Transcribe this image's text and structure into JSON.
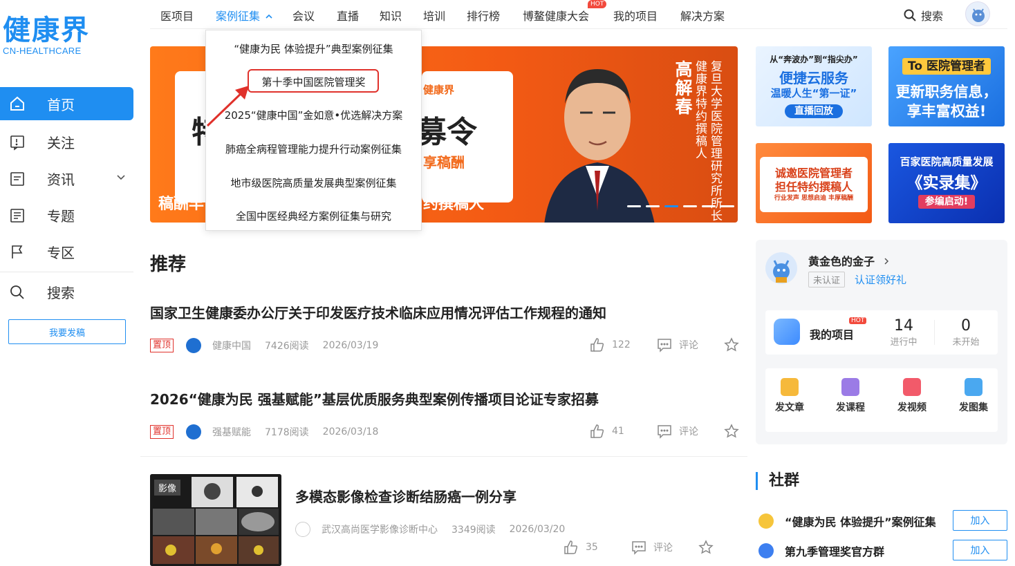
{
  "logo": {
    "cn": "健康界",
    "en": "CN-HEALTHCARE"
  },
  "sidebar": {
    "items": [
      {
        "label": "首页",
        "icon": "home-icon"
      },
      {
        "label": "关注",
        "icon": "follow-icon"
      },
      {
        "label": "资讯",
        "icon": "news-icon"
      },
      {
        "label": "专题",
        "icon": "topic-icon"
      },
      {
        "label": "专区",
        "icon": "flag-icon"
      },
      {
        "label": "搜索",
        "icon": "search-icon"
      }
    ],
    "post_button": "我要发稿"
  },
  "topnav": {
    "items": [
      "医项目",
      "案例征集",
      "会议",
      "直播",
      "知识",
      "培训",
      "排行榜",
      "博鳌健康大会",
      "我的项目",
      "解决方案"
    ],
    "hot_badge": "HOT",
    "search_label": "搜索"
  },
  "dropdown": {
    "items": [
      "“健康为民 体验提升”典型案例征集",
      "第十季中国医院管理奖",
      "2025“健康中国”金如意•优选解决方案",
      "肺癌全病程管理能力提升行动案例征集",
      "地市级医院高质量发展典型案例征集",
      "全国中医经典经方案例征集与研究"
    ]
  },
  "banner": {
    "char_left": "特",
    "big_text": "募令",
    "sub_text": "享稿酬",
    "logo_mini": "健康界",
    "bottom_left": "稿酬丰",
    "bottom_right": "约撰稿人",
    "name_vertical": "高解春",
    "title_vertical": "复旦大学医院管理研究所所长 健康界特约撰稿人"
  },
  "ads": {
    "ad1": {
      "line1": "从“奔波办”到“指尖办”",
      "line2": "便捷云服务",
      "line3": "温暖人生“第一证”",
      "line4": "直播回放"
    },
    "ad2": {
      "line1": "To 医院管理者",
      "line2": "更新职务信息，",
      "line3": "享丰富权益!"
    },
    "ad3": {
      "line1": "诚邀医院管理者",
      "line2": "担任特约撰稿人",
      "line3": "行业发声  思想启迪  丰厚稿酬"
    },
    "ad4": {
      "line1": "百家医院高质量发展",
      "line2": "《实录集》",
      "line3": "参编启动!"
    }
  },
  "recommend": {
    "title": "推荐",
    "articles": [
      {
        "title": "国家卫生健康委办公厅关于印发医疗技术临床应用情况评估工作规程的通知",
        "badge": "置顶",
        "source": "健康中国",
        "reads": "7426阅读",
        "date": "2026/03/19",
        "likes": "122",
        "comment": "评论"
      },
      {
        "title": "2026“健康为民 强基赋能”基层优质服务典型案例传播项目论证专家招募",
        "badge": "置顶",
        "source": "强基赋能",
        "reads": "7178阅读",
        "date": "2026/03/18",
        "likes": "41",
        "comment": "评论"
      },
      {
        "title": "多模态影像检查诊断结肠癌一例分享",
        "badge": "",
        "source": "武汉高尚医学影像诊断中心",
        "reads": "3349阅读",
        "date": "2026/03/20",
        "likes": "35",
        "comment": "评论",
        "thumb_label": "影像"
      }
    ]
  },
  "profile": {
    "name": "黄金色的金子",
    "unverified": "未认证",
    "cert_link": "认证领好礼",
    "project_label": "我的项目",
    "hot": "HOT",
    "stats": [
      {
        "n": "14",
        "l": "进行中"
      },
      {
        "n": "0",
        "l": "未开始"
      }
    ],
    "tools": [
      "发文章",
      "发课程",
      "发视频",
      "发图集"
    ]
  },
  "community": {
    "title": "社群",
    "groups": [
      {
        "name": "“健康为民 体验提升”案例征集",
        "join": "加入"
      },
      {
        "name": "第九季管理奖官方群",
        "join": "加入"
      }
    ]
  }
}
